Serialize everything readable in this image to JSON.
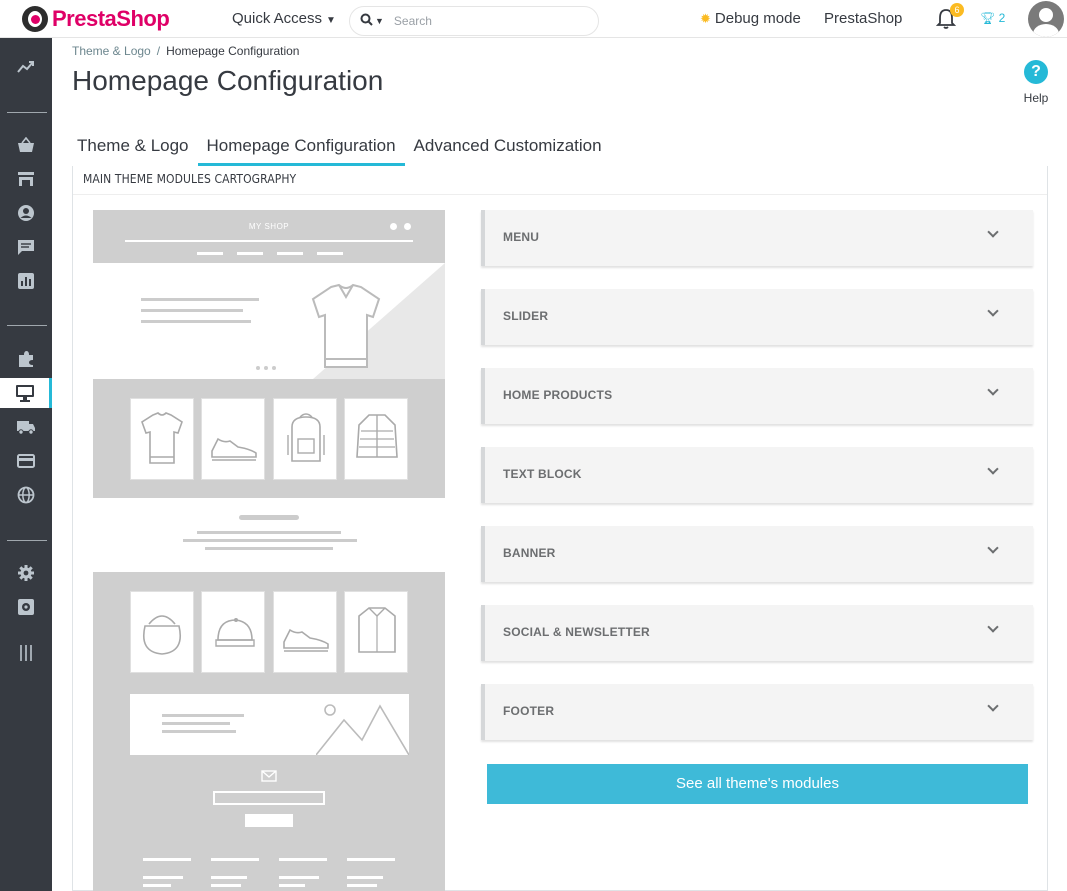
{
  "topbar": {
    "logo_text": "PrestaShop",
    "quick_access": "Quick Access",
    "search_placeholder": "Search",
    "debug_mode": "Debug mode",
    "shop_name": "PrestaShop",
    "notifications_count": "6",
    "trophy_count": "2"
  },
  "sidebar": {
    "items": [
      {
        "icon": "dashboard-icon"
      },
      {
        "icon": "orders-icon"
      },
      {
        "icon": "catalog-icon"
      },
      {
        "icon": "customers-icon"
      },
      {
        "icon": "messages-icon"
      },
      {
        "icon": "stats-icon"
      },
      {
        "icon": "modules-icon"
      },
      {
        "icon": "design-icon",
        "active": true
      },
      {
        "icon": "shipping-icon"
      },
      {
        "icon": "payment-icon"
      },
      {
        "icon": "international-icon"
      },
      {
        "icon": "settings-icon"
      },
      {
        "icon": "advanced-settings-icon"
      },
      {
        "icon": "collapse-icon"
      }
    ]
  },
  "breadcrumb": {
    "parent": "Theme & Logo",
    "separator": "/",
    "current": "Homepage Configuration"
  },
  "page_title": "Homepage Configuration",
  "help_label": "Help",
  "tabs": [
    {
      "label": "Theme & Logo"
    },
    {
      "label": "Homepage Configuration",
      "active": true
    },
    {
      "label": "Advanced Customization"
    }
  ],
  "panel": {
    "heading": "MAIN THEME MODULES CARTOGRAPHY",
    "mock_shop_label": "MY SHOP",
    "sections": [
      {
        "label": "MENU"
      },
      {
        "label": "SLIDER"
      },
      {
        "label": "HOME PRODUCTS"
      },
      {
        "label": "TEXT BLOCK"
      },
      {
        "label": "BANNER"
      },
      {
        "label": "SOCIAL & NEWSLETTER"
      },
      {
        "label": "FOOTER"
      }
    ],
    "see_all_button": "See all theme's modules"
  },
  "colors": {
    "brand": "#df0067",
    "accent": "#25b9d7",
    "sidebar_bg": "#363a41",
    "warning": "#fbbb22"
  }
}
